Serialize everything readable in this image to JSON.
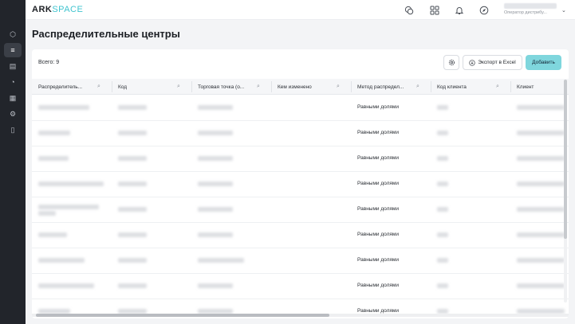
{
  "app": {
    "logo_ark": "ARK",
    "logo_space": "SPACE"
  },
  "sidebar": {
    "items": [
      {
        "icon": "cube-icon",
        "glyph": "⬡",
        "active": false
      },
      {
        "icon": "database-icon",
        "glyph": "≡",
        "active": true
      },
      {
        "icon": "panel-icon",
        "glyph": "▤",
        "active": false
      },
      {
        "icon": "chart-pie-icon",
        "glyph": "◔",
        "active": false
      },
      {
        "icon": "layers-icon",
        "glyph": "▦",
        "active": false
      },
      {
        "icon": "settings-icon",
        "glyph": "⚙",
        "active": false
      },
      {
        "icon": "book-icon",
        "glyph": "▯",
        "active": false
      }
    ]
  },
  "topbar": {
    "icons": [
      "support-icon",
      "apps-grid-icon",
      "bell-icon",
      "compass-icon"
    ],
    "user_role": "Оператор дистрибу..."
  },
  "page": {
    "title": "Распределительные центры"
  },
  "toolbar": {
    "total": "Всего: 9",
    "export_label": "Экспорт в Excel",
    "add_label": "Добавить"
  },
  "table": {
    "columns": [
      "Распределитель...",
      "Код",
      "Торговая точка (о...",
      "Кем изменено",
      "Метод распредел...",
      "Код клиента",
      "Клиент"
    ],
    "rows": [
      {
        "method": "Равными долями"
      },
      {
        "method": "Равными долями"
      },
      {
        "method": "Равными долями"
      },
      {
        "method": "Равными долями"
      },
      {
        "method": "Равными долями"
      },
      {
        "method": "Равными долями"
      },
      {
        "method": "Равными долями"
      },
      {
        "method": "Равными долями"
      },
      {
        "method": "Равными долями"
      }
    ]
  }
}
